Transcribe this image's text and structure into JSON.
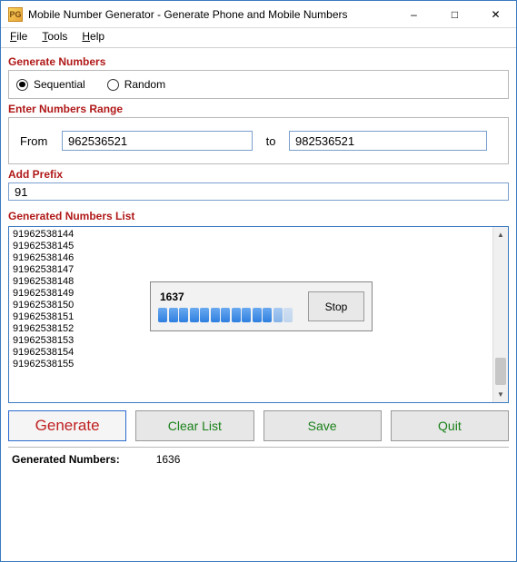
{
  "window": {
    "title": "Mobile Number Generator - Generate Phone and Mobile Numbers",
    "icon_label": "PG"
  },
  "menu": {
    "file": "File",
    "tools": "Tools",
    "help": "Help"
  },
  "sections": {
    "generate_title": "Generate Numbers",
    "range_title": "Enter Numbers Range",
    "prefix_title": "Add Prefix",
    "list_title": "Generated Numbers List"
  },
  "radio": {
    "sequential": "Sequential",
    "random": "Random",
    "selected": "sequential"
  },
  "range": {
    "from_label": "From",
    "from_value": "962536521",
    "to_label": "to",
    "to_value": "982536521"
  },
  "prefix": {
    "value": "91"
  },
  "list": {
    "items": [
      "91962538144",
      "91962538145",
      "91962538146",
      "91962538147",
      "91962538148",
      "91962538149",
      "91962538150",
      "91962538151",
      "91962538152",
      "91962538153",
      "91962538154",
      "91962538155"
    ]
  },
  "progress": {
    "count": "1637",
    "stop_label": "Stop"
  },
  "buttons": {
    "generate": "Generate",
    "clear": "Clear List",
    "save": "Save",
    "quit": "Quit"
  },
  "status": {
    "label": "Generated Numbers:",
    "value": "1636"
  }
}
